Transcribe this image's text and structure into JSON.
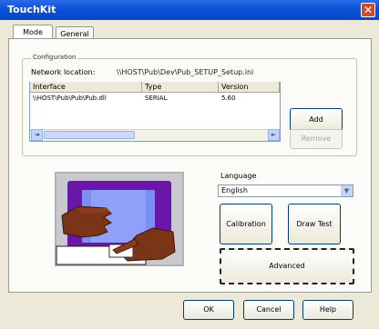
{
  "window": {
    "title": "TouchKit",
    "close_glyph": "✕"
  },
  "tabs": [
    {
      "label": "Mode"
    },
    {
      "label": "General"
    }
  ],
  "group": {
    "label": "Configuration"
  },
  "network": {
    "label": "Network location:",
    "value": "\\\\HOST\\Pub\\Dev\\Pub_SETUP_Setup.ini"
  },
  "table": {
    "columns": [
      "Interface",
      "Type",
      "Version"
    ],
    "rows": [
      {
        "interface": "\\\\HOST\\Pub\\Pub\\Pub.dll",
        "type": "SERIAL",
        "version": "5.60"
      }
    ]
  },
  "buttons": {
    "add": "Add",
    "remove": "Remove",
    "calibration": "Calibration",
    "draw_test": "Draw Test",
    "advanced": "Advanced",
    "ok": "OK",
    "cancel": "Cancel",
    "help": "Help"
  },
  "language": {
    "label": "Language",
    "value": "English"
  },
  "icons": {
    "scroll_left": "◄",
    "scroll_right": "►",
    "combo_arrow": "▼"
  }
}
